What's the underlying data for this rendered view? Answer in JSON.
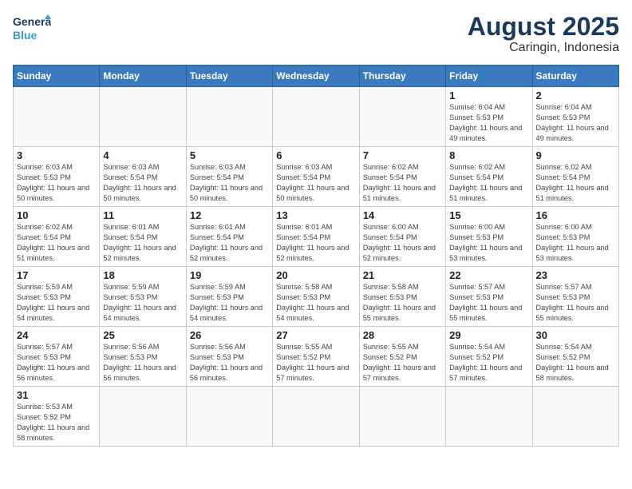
{
  "header": {
    "logo_general": "General",
    "logo_blue": "Blue",
    "month_year": "August 2025",
    "location": "Caringin, Indonesia"
  },
  "weekdays": [
    "Sunday",
    "Monday",
    "Tuesday",
    "Wednesday",
    "Thursday",
    "Friday",
    "Saturday"
  ],
  "weeks": [
    [
      {
        "day": "",
        "info": ""
      },
      {
        "day": "",
        "info": ""
      },
      {
        "day": "",
        "info": ""
      },
      {
        "day": "",
        "info": ""
      },
      {
        "day": "",
        "info": ""
      },
      {
        "day": "1",
        "info": "Sunrise: 6:04 AM\nSunset: 5:53 PM\nDaylight: 11 hours\nand 49 minutes."
      },
      {
        "day": "2",
        "info": "Sunrise: 6:04 AM\nSunset: 5:53 PM\nDaylight: 11 hours\nand 49 minutes."
      }
    ],
    [
      {
        "day": "3",
        "info": "Sunrise: 6:03 AM\nSunset: 5:53 PM\nDaylight: 11 hours\nand 50 minutes."
      },
      {
        "day": "4",
        "info": "Sunrise: 6:03 AM\nSunset: 5:54 PM\nDaylight: 11 hours\nand 50 minutes."
      },
      {
        "day": "5",
        "info": "Sunrise: 6:03 AM\nSunset: 5:54 PM\nDaylight: 11 hours\nand 50 minutes."
      },
      {
        "day": "6",
        "info": "Sunrise: 6:03 AM\nSunset: 5:54 PM\nDaylight: 11 hours\nand 50 minutes."
      },
      {
        "day": "7",
        "info": "Sunrise: 6:02 AM\nSunset: 5:54 PM\nDaylight: 11 hours\nand 51 minutes."
      },
      {
        "day": "8",
        "info": "Sunrise: 6:02 AM\nSunset: 5:54 PM\nDaylight: 11 hours\nand 51 minutes."
      },
      {
        "day": "9",
        "info": "Sunrise: 6:02 AM\nSunset: 5:54 PM\nDaylight: 11 hours\nand 51 minutes."
      }
    ],
    [
      {
        "day": "10",
        "info": "Sunrise: 6:02 AM\nSunset: 5:54 PM\nDaylight: 11 hours\nand 51 minutes."
      },
      {
        "day": "11",
        "info": "Sunrise: 6:01 AM\nSunset: 5:54 PM\nDaylight: 11 hours\nand 52 minutes."
      },
      {
        "day": "12",
        "info": "Sunrise: 6:01 AM\nSunset: 5:54 PM\nDaylight: 11 hours\nand 52 minutes."
      },
      {
        "day": "13",
        "info": "Sunrise: 6:01 AM\nSunset: 5:54 PM\nDaylight: 11 hours\nand 52 minutes."
      },
      {
        "day": "14",
        "info": "Sunrise: 6:00 AM\nSunset: 5:54 PM\nDaylight: 11 hours\nand 52 minutes."
      },
      {
        "day": "15",
        "info": "Sunrise: 6:00 AM\nSunset: 5:53 PM\nDaylight: 11 hours\nand 53 minutes."
      },
      {
        "day": "16",
        "info": "Sunrise: 6:00 AM\nSunset: 5:53 PM\nDaylight: 11 hours\nand 53 minutes."
      }
    ],
    [
      {
        "day": "17",
        "info": "Sunrise: 5:59 AM\nSunset: 5:53 PM\nDaylight: 11 hours\nand 54 minutes."
      },
      {
        "day": "18",
        "info": "Sunrise: 5:59 AM\nSunset: 5:53 PM\nDaylight: 11 hours\nand 54 minutes."
      },
      {
        "day": "19",
        "info": "Sunrise: 5:59 AM\nSunset: 5:53 PM\nDaylight: 11 hours\nand 54 minutes."
      },
      {
        "day": "20",
        "info": "Sunrise: 5:58 AM\nSunset: 5:53 PM\nDaylight: 11 hours\nand 54 minutes."
      },
      {
        "day": "21",
        "info": "Sunrise: 5:58 AM\nSunset: 5:53 PM\nDaylight: 11 hours\nand 55 minutes."
      },
      {
        "day": "22",
        "info": "Sunrise: 5:57 AM\nSunset: 5:53 PM\nDaylight: 11 hours\nand 55 minutes."
      },
      {
        "day": "23",
        "info": "Sunrise: 5:57 AM\nSunset: 5:53 PM\nDaylight: 11 hours\nand 55 minutes."
      }
    ],
    [
      {
        "day": "24",
        "info": "Sunrise: 5:57 AM\nSunset: 5:53 PM\nDaylight: 11 hours\nand 56 minutes."
      },
      {
        "day": "25",
        "info": "Sunrise: 5:56 AM\nSunset: 5:53 PM\nDaylight: 11 hours\nand 56 minutes."
      },
      {
        "day": "26",
        "info": "Sunrise: 5:56 AM\nSunset: 5:53 PM\nDaylight: 11 hours\nand 56 minutes."
      },
      {
        "day": "27",
        "info": "Sunrise: 5:55 AM\nSunset: 5:52 PM\nDaylight: 11 hours\nand 57 minutes."
      },
      {
        "day": "28",
        "info": "Sunrise: 5:55 AM\nSunset: 5:52 PM\nDaylight: 11 hours\nand 57 minutes."
      },
      {
        "day": "29",
        "info": "Sunrise: 5:54 AM\nSunset: 5:52 PM\nDaylight: 11 hours\nand 57 minutes."
      },
      {
        "day": "30",
        "info": "Sunrise: 5:54 AM\nSunset: 5:52 PM\nDaylight: 11 hours\nand 58 minutes."
      }
    ],
    [
      {
        "day": "31",
        "info": "Sunrise: 5:53 AM\nSunset: 5:52 PM\nDaylight: 11 hours\nand 58 minutes."
      },
      {
        "day": "",
        "info": ""
      },
      {
        "day": "",
        "info": ""
      },
      {
        "day": "",
        "info": ""
      },
      {
        "day": "",
        "info": ""
      },
      {
        "day": "",
        "info": ""
      },
      {
        "day": "",
        "info": ""
      }
    ]
  ]
}
